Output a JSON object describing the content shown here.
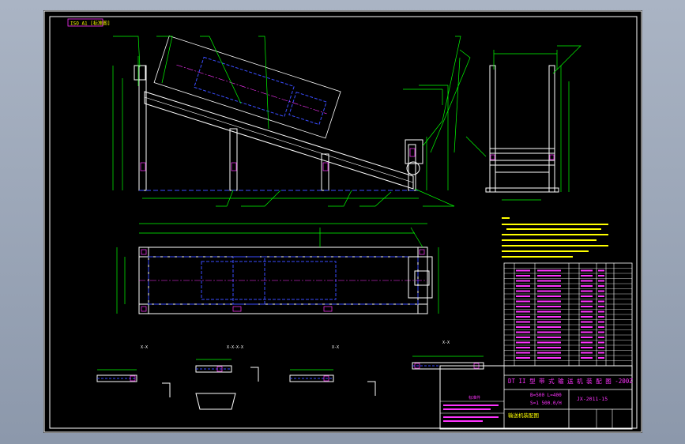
{
  "drawing": {
    "corner_tag": "ISO A1 [标准图]",
    "section_labels": [
      "X-X",
      "X-X-X-X",
      "X-X",
      "X-X"
    ],
    "title_line": "DT II 型  带 式 输 送 机 装 配 图 -200Z",
    "spec_line_1": "B=500  L=400",
    "spec_line_2": "S=1 500.0/H",
    "drawing_no": "JX-2011-15",
    "stamp_label": "标准件",
    "footer_label": "输送机装配图"
  },
  "colors": {
    "background": "#000000",
    "frame": "#ffffff",
    "outline": "#ffffff",
    "dimension": "#00ff00",
    "hidden": "#3a4dff",
    "text": "#ffff00",
    "table_text": "#ff33ff",
    "annotation": "#00e5ff"
  }
}
